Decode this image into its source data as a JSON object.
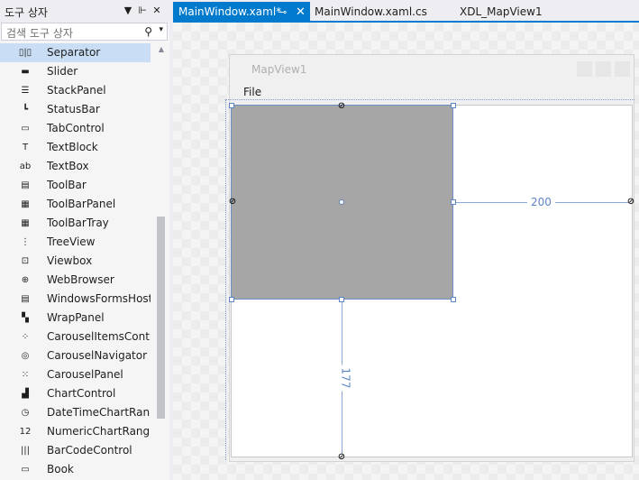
{
  "toolbox": {
    "title": "도구 상자",
    "dropdown_icon": "▼",
    "pin_icon": "⊩",
    "close_icon": "✕",
    "search_placeholder": "검색 도구 상자",
    "search_icon": "⚲",
    "search_dropdown_icon": "▾",
    "scroll_up_icon": "▲",
    "items": [
      {
        "label": "Separator",
        "icon": "separator-icon",
        "glyph": "▯|▯",
        "selected": true
      },
      {
        "label": "Slider",
        "icon": "slider-icon",
        "glyph": "▬"
      },
      {
        "label": "StackPanel",
        "icon": "stackpanel-icon",
        "glyph": "☰"
      },
      {
        "label": "StatusBar",
        "icon": "statusbar-icon",
        "glyph": "┗"
      },
      {
        "label": "TabControl",
        "icon": "tabcontrol-icon",
        "glyph": "▭"
      },
      {
        "label": "TextBlock",
        "icon": "textblock-icon",
        "glyph": "T"
      },
      {
        "label": "TextBox",
        "icon": "textbox-icon",
        "glyph": "ab"
      },
      {
        "label": "ToolBar",
        "icon": "toolbar-icon",
        "glyph": "▤"
      },
      {
        "label": "ToolBarPanel",
        "icon": "toolbarpanel-icon",
        "glyph": "▦"
      },
      {
        "label": "ToolBarTray",
        "icon": "toolbartray-icon",
        "glyph": "▦"
      },
      {
        "label": "TreeView",
        "icon": "treeview-icon",
        "glyph": "⋮"
      },
      {
        "label": "Viewbox",
        "icon": "viewbox-icon",
        "glyph": "⊡"
      },
      {
        "label": "WebBrowser",
        "icon": "webbrowser-icon",
        "glyph": "⊕"
      },
      {
        "label": "WindowsFormsHost",
        "icon": "windowsformshost-icon",
        "glyph": "▤"
      },
      {
        "label": "WrapPanel",
        "icon": "wrappanel-icon",
        "glyph": "▚"
      },
      {
        "label": "CarouselItemsContr...",
        "icon": "carouselitemscontrol-icon",
        "glyph": "⁘"
      },
      {
        "label": "CarouselNavigator",
        "icon": "carouselnavigator-icon",
        "glyph": "◎"
      },
      {
        "label": "CarouselPanel",
        "icon": "carouselpanel-icon",
        "glyph": "⁙"
      },
      {
        "label": "ChartControl",
        "icon": "chartcontrol-icon",
        "glyph": "▟"
      },
      {
        "label": "DateTimeChartRan...",
        "icon": "datetimechartrange-icon",
        "glyph": "◷"
      },
      {
        "label": "NumericChartRang...",
        "icon": "numericchartrange-icon",
        "glyph": "12"
      },
      {
        "label": "BarCodeControl",
        "icon": "barcode-icon",
        "glyph": "|||"
      },
      {
        "label": "Book",
        "icon": "book-icon",
        "glyph": "▭"
      }
    ]
  },
  "tabs": [
    {
      "label": "MainWindow.xaml*",
      "active": true,
      "pin_icon": "⊸",
      "close_icon": "✕"
    },
    {
      "label": "MainWindow.xaml.cs",
      "active": false
    },
    {
      "label": "XDL_MapView1",
      "active": false
    }
  ],
  "designer": {
    "window_title": "MapView1",
    "menu_file": "File",
    "width_label": "200",
    "height_label": "177",
    "anchor_glyph": "⊘"
  },
  "colors": {
    "accent": "#007acc",
    "selection": "#c9def5",
    "map_fill": "#a6a6a6",
    "guide": "#5d86c6"
  }
}
